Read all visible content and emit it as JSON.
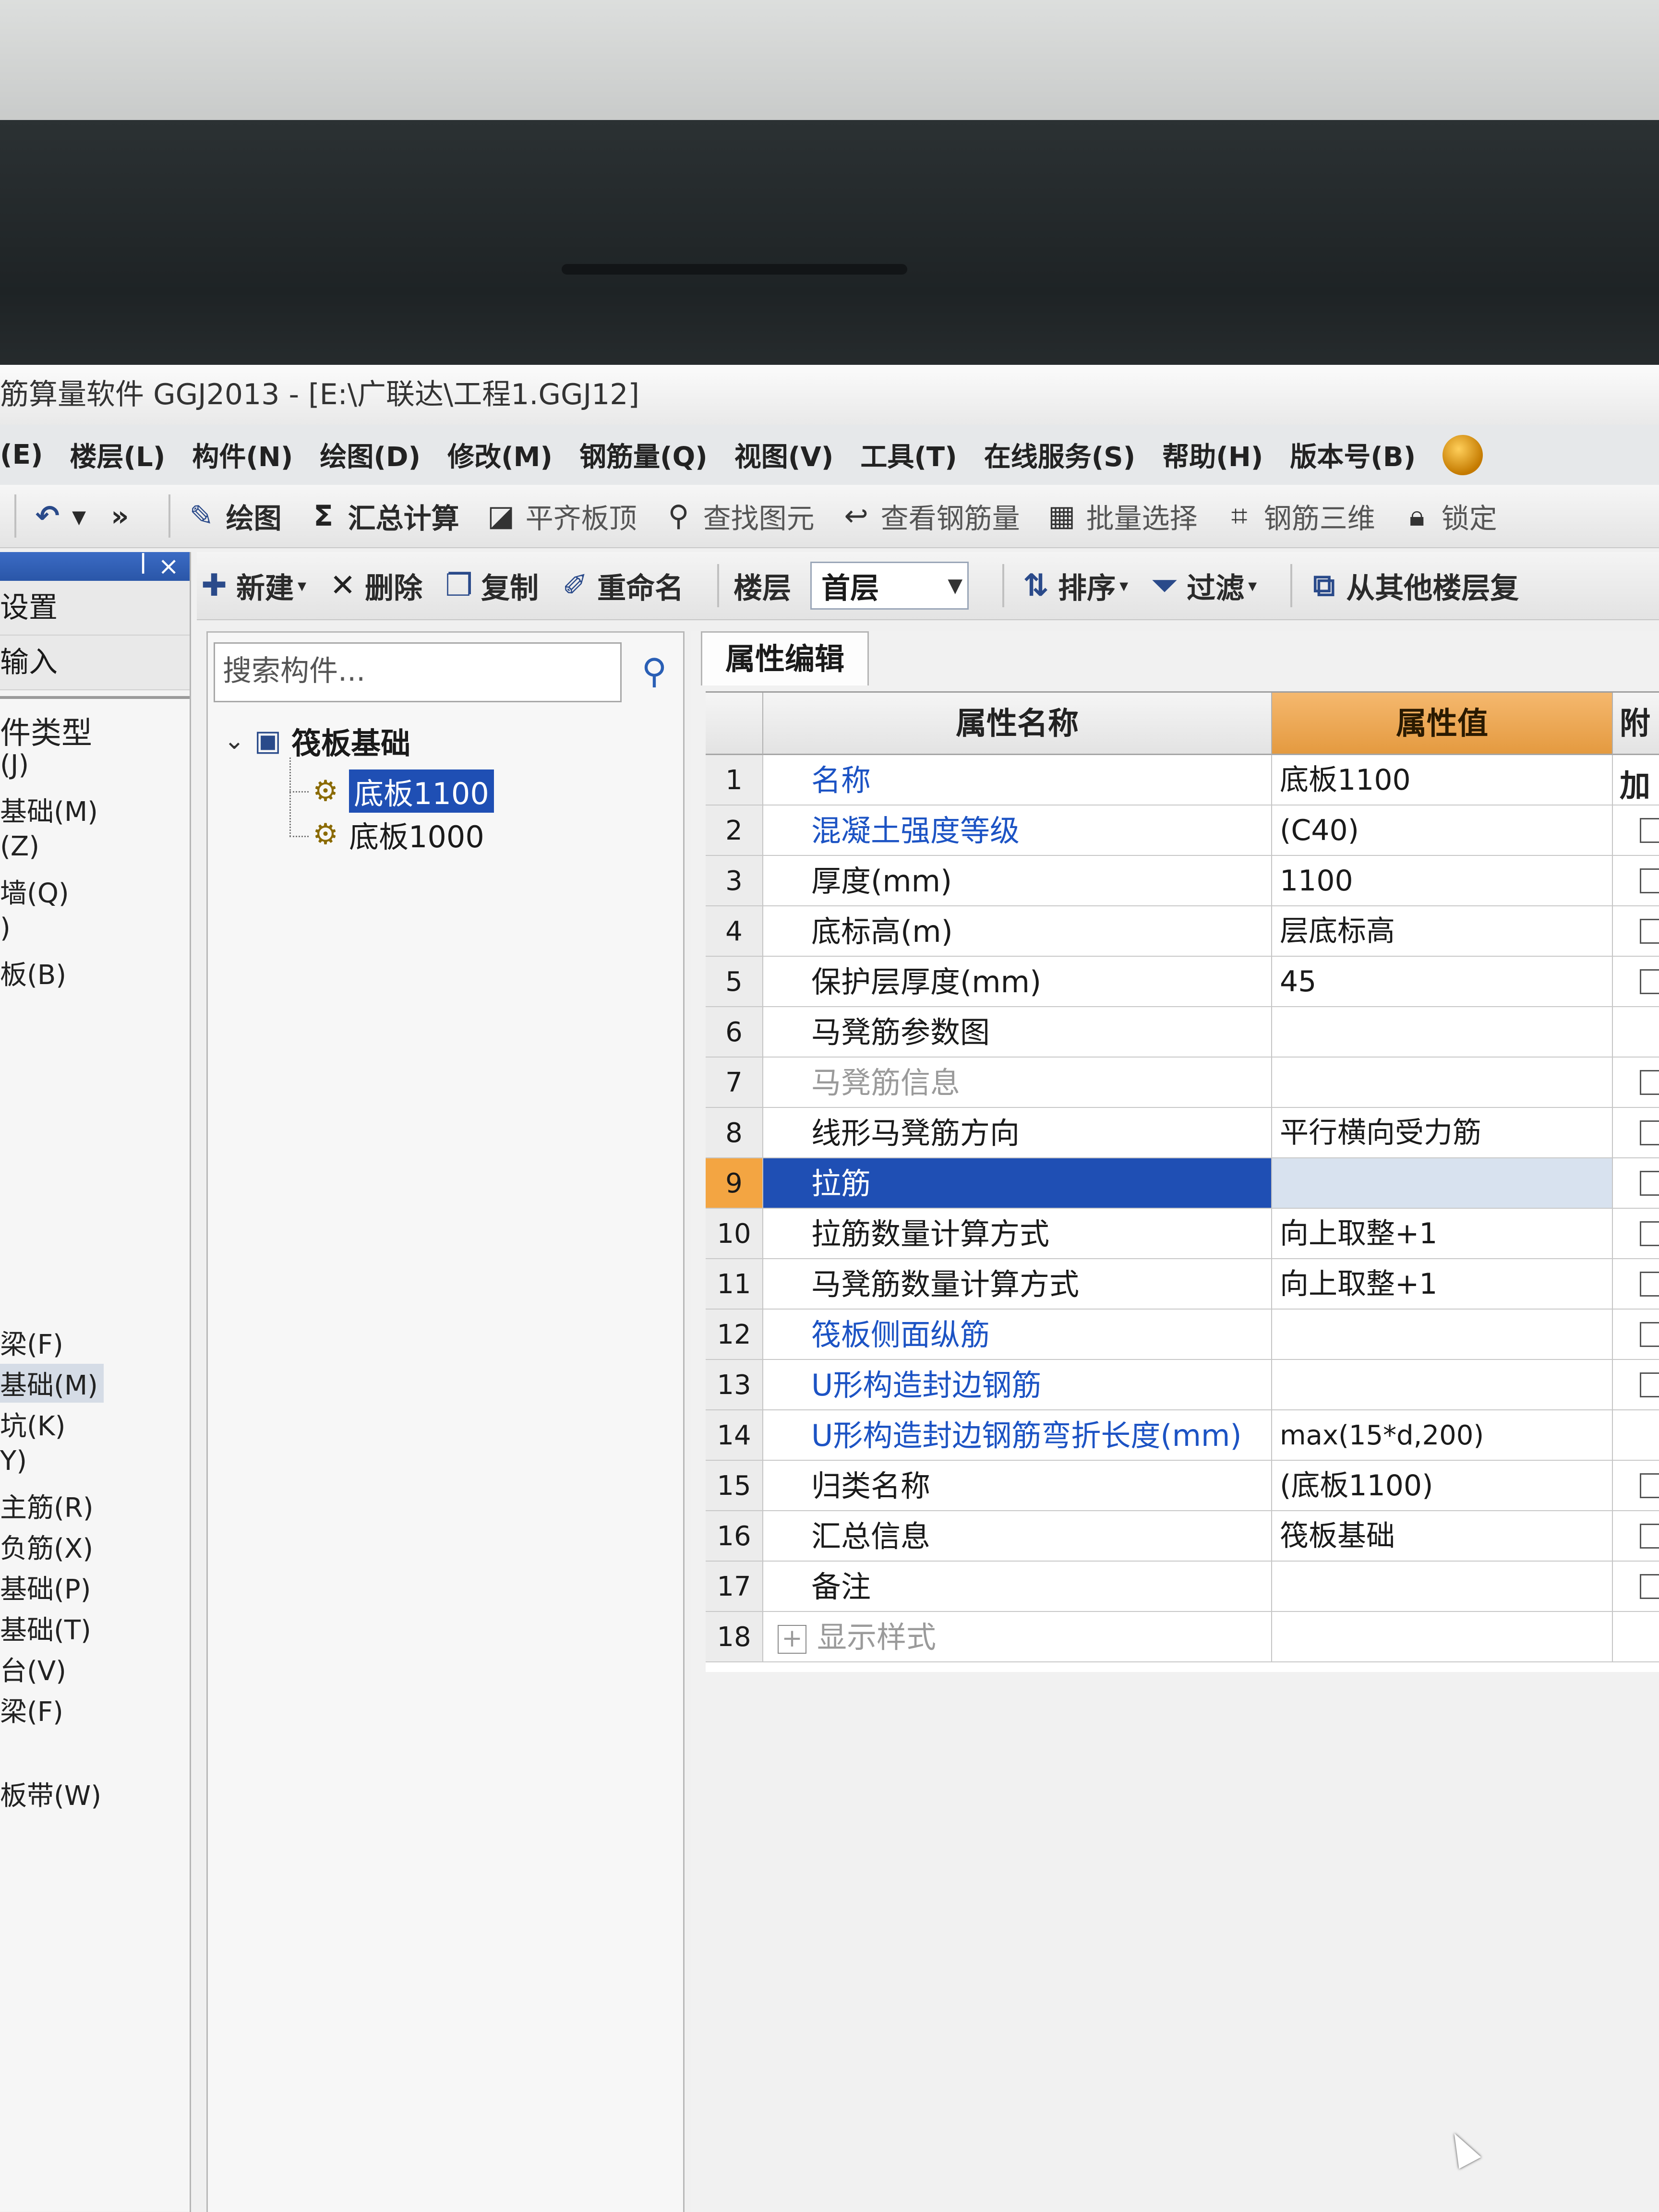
{
  "window": {
    "title": "筋算量软件 GGJ2013 - [E:\\广联达\\工程1.GGJ12]"
  },
  "menu": [
    "(E)",
    "楼层(L)",
    "构件(N)",
    "绘图(D)",
    "修改(M)",
    "钢筋量(Q)",
    "视图(V)",
    "工具(T)",
    "在线服务(S)",
    "帮助(H)",
    "版本号(B)"
  ],
  "toolbar": {
    "undo_arrow": "▾",
    "more": "»",
    "draw": "绘图",
    "sum_calc": "汇总计算",
    "flush_slab_top": "平齐板顶",
    "find_element": "查找图元",
    "view_rebar": "查看钢筋量",
    "batch_select": "批量选择",
    "rebar_3d": "钢筋三维",
    "lock": "锁定"
  },
  "component_toolbar": {
    "new": "新建",
    "delete": "删除",
    "copy": "复制",
    "rename": "重命名",
    "floor_label": "楼层",
    "floor_value": "首层",
    "sort": "排序",
    "filter": "过滤",
    "copy_from_other": "从其他楼层复"
  },
  "left_panel": {
    "tabs": [
      "设置",
      "输入"
    ],
    "items": [
      "件类型",
      "(J)",
      "基础(M)",
      "(Z)",
      "墙(Q)",
      ")",
      "板(B)",
      "梁(F)",
      "基础(M)",
      "坑(K)",
      "Y)",
      "主筋(R)",
      "负筋(X)",
      "基础(P)",
      "基础(T)",
      "台(V)",
      "梁(F)",
      "板带(W)"
    ]
  },
  "tree": {
    "search_placeholder": "搜索构件...",
    "root": "筏板基础",
    "children": [
      "底板1100",
      "底板1000"
    ]
  },
  "properties": {
    "tab": "属性编辑",
    "headers": {
      "name": "属性名称",
      "value": "属性值",
      "extra": "附加"
    },
    "rows": [
      {
        "num": "1",
        "name": "名称",
        "value": "底板1100"
      },
      {
        "num": "2",
        "name": "混凝土强度等级",
        "value": "(C40)"
      },
      {
        "num": "3",
        "name": "厚度(mm)",
        "value": "1100"
      },
      {
        "num": "4",
        "name": "底标高(m)",
        "value": "层底标高"
      },
      {
        "num": "5",
        "name": "保护层厚度(mm)",
        "value": "45"
      },
      {
        "num": "6",
        "name": "马凳筋参数图",
        "value": ""
      },
      {
        "num": "7",
        "name": "马凳筋信息",
        "value": ""
      },
      {
        "num": "8",
        "name": "线形马凳筋方向",
        "value": "平行横向受力筋"
      },
      {
        "num": "9",
        "name": "拉筋",
        "value": ""
      },
      {
        "num": "10",
        "name": "拉筋数量计算方式",
        "value": "向上取整+1"
      },
      {
        "num": "11",
        "name": "马凳筋数量计算方式",
        "value": "向上取整+1"
      },
      {
        "num": "12",
        "name": "筏板侧面纵筋",
        "value": ""
      },
      {
        "num": "13",
        "name": "U形构造封边钢筋",
        "value": ""
      },
      {
        "num": "14",
        "name": "U形构造封边钢筋弯折长度(mm)",
        "value": "max(15*d,200)"
      },
      {
        "num": "15",
        "name": "归类名称",
        "value": "(底板1100)"
      },
      {
        "num": "16",
        "name": "汇总信息",
        "value": "筏板基础"
      },
      {
        "num": "17",
        "name": "备注",
        "value": ""
      },
      {
        "num": "18",
        "name": "显示样式",
        "value": "",
        "expand": "+"
      }
    ]
  }
}
